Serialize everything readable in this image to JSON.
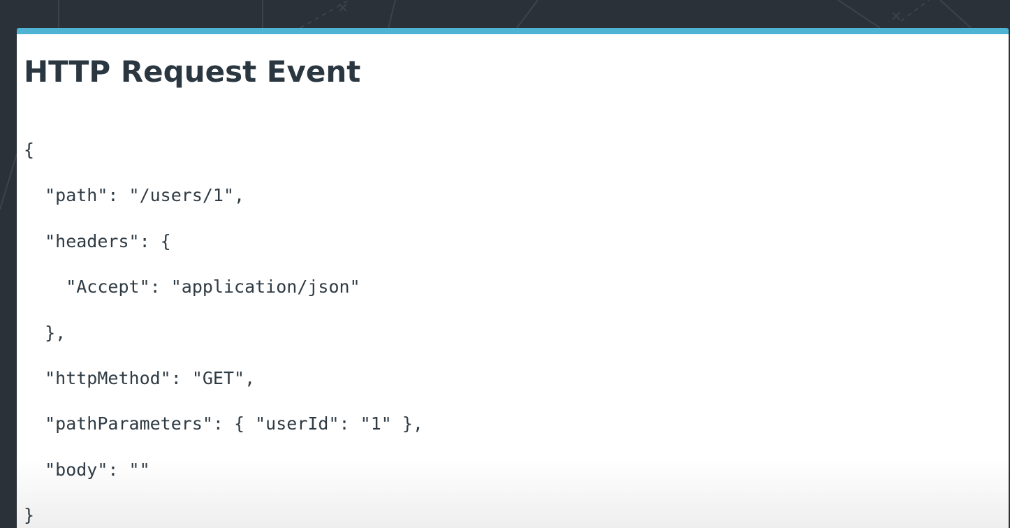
{
  "slide": {
    "title": "HTTP Request Event",
    "accent_color": "#4fb3d3",
    "code_lines": [
      "{",
      "  \"path\": \"/users/1\",",
      "  \"headers\": {",
      "    \"Accept\": \"application/json\"",
      "  },",
      "  \"httpMethod\": \"GET\",",
      "  \"pathParameters\": { \"userId\": \"1\" },",
      "  \"body\": \"\"",
      "}"
    ]
  }
}
